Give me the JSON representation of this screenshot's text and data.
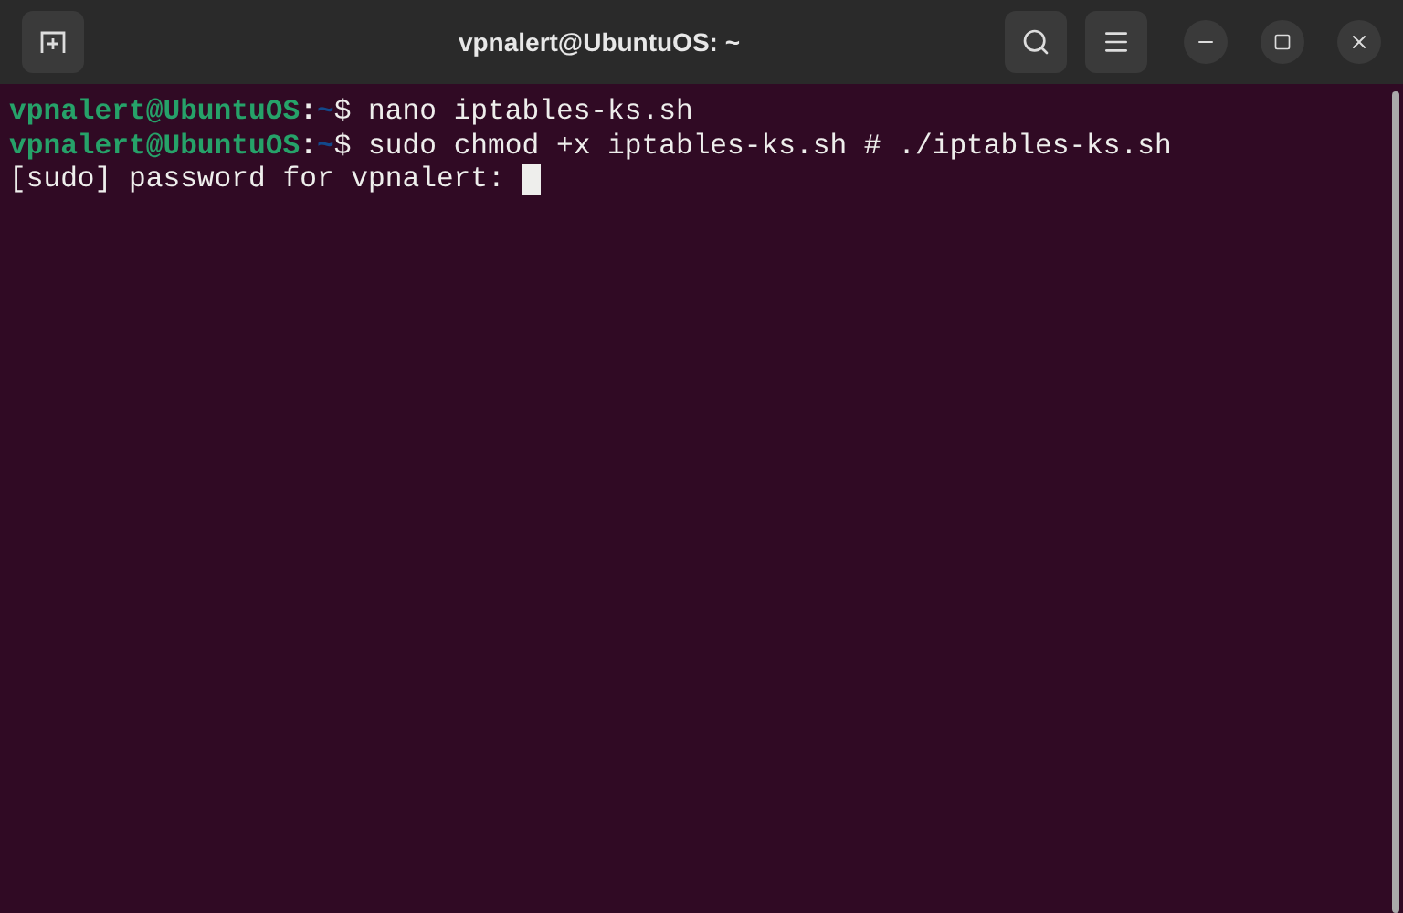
{
  "window": {
    "title": "vpnalert@UbuntuOS: ~"
  },
  "lines": [
    {
      "kind": "prompt",
      "user_host": "vpnalert@UbuntuOS",
      "separator": ":",
      "path": "~",
      "symbol": "$",
      "command": "nano iptables-ks.sh"
    },
    {
      "kind": "prompt",
      "user_host": "vpnalert@UbuntuOS",
      "separator": ":",
      "path": "~",
      "symbol": "$",
      "command": "sudo chmod +x iptables-ks.sh # ./iptables-ks.sh"
    },
    {
      "kind": "output",
      "text": "[sudo] password for vpnalert:",
      "cursor": true
    }
  ]
}
